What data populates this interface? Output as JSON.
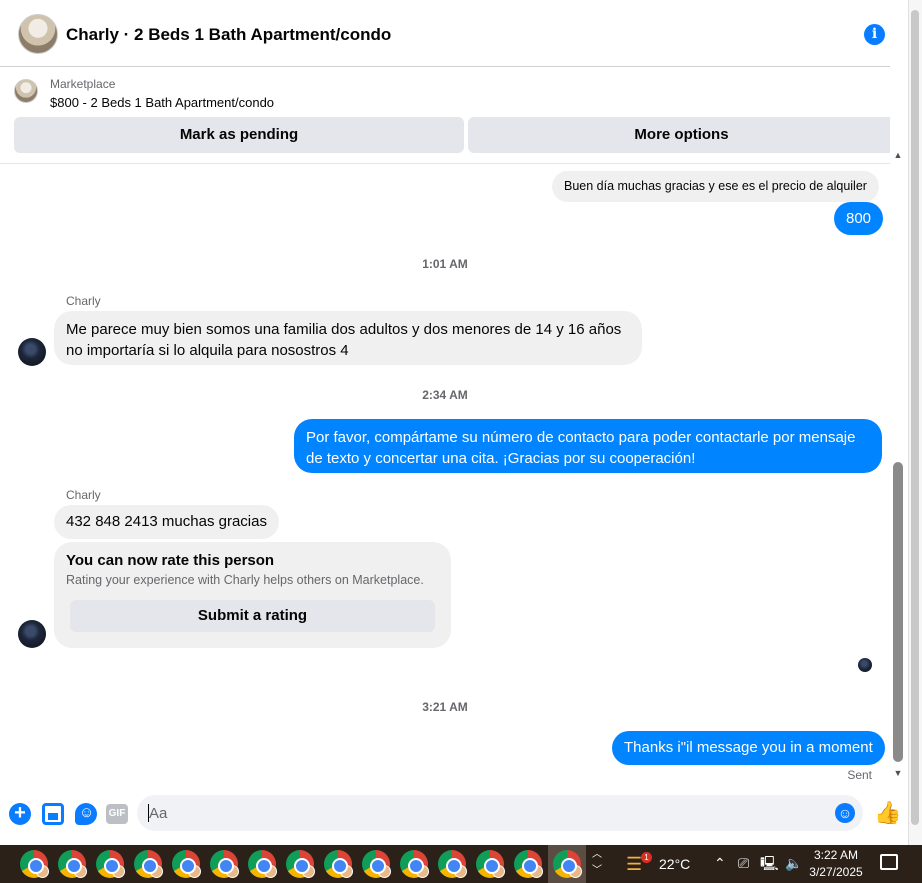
{
  "header": {
    "title": "Charly · 2 Beds 1 Bath Apartment/condo"
  },
  "listing": {
    "source": "Marketplace",
    "price_title": "$800 - 2 Beds 1 Bath Apartment/condo",
    "mark_pending": "Mark as pending",
    "more_options": "More options"
  },
  "messages": {
    "m1": "Buen día muchas gracias y ese es el precio de alquiler",
    "m2": "800",
    "t1": "1:01 AM",
    "sender1": "Charly",
    "m3_line1": "Me parece muy bien somos una familia dos adultos y dos menores de 14 y 16 años",
    "m3_line2": "no importaría si lo alquila para nosostros 4",
    "t2": "2:34 AM",
    "m4_line1": "Por favor, compártame su número de contacto para poder contactarle por mensaje",
    "m4_line2": "de texto y concertar una cita. ¡Gracias por su cooperación!",
    "sender2": "Charly",
    "m5": "432 848 2413 muchas gracias",
    "rate_title": "You can now rate this person",
    "rate_sub": "Rating your experience with Charly helps others on Marketplace.",
    "rate_button": "Submit a rating",
    "t3": "3:21 AM",
    "m6": "Thanks i\"il message you in a moment",
    "status": "Sent"
  },
  "composer": {
    "placeholder": "Aa",
    "gif_label": "GIF"
  },
  "taskbar": {
    "temperature": "22°C",
    "weather_badge": "1",
    "time": "3:22 AM",
    "date": "3/27/2025"
  },
  "colors": {
    "accent": "#0084ff",
    "incoming": "#f0f0f0"
  }
}
